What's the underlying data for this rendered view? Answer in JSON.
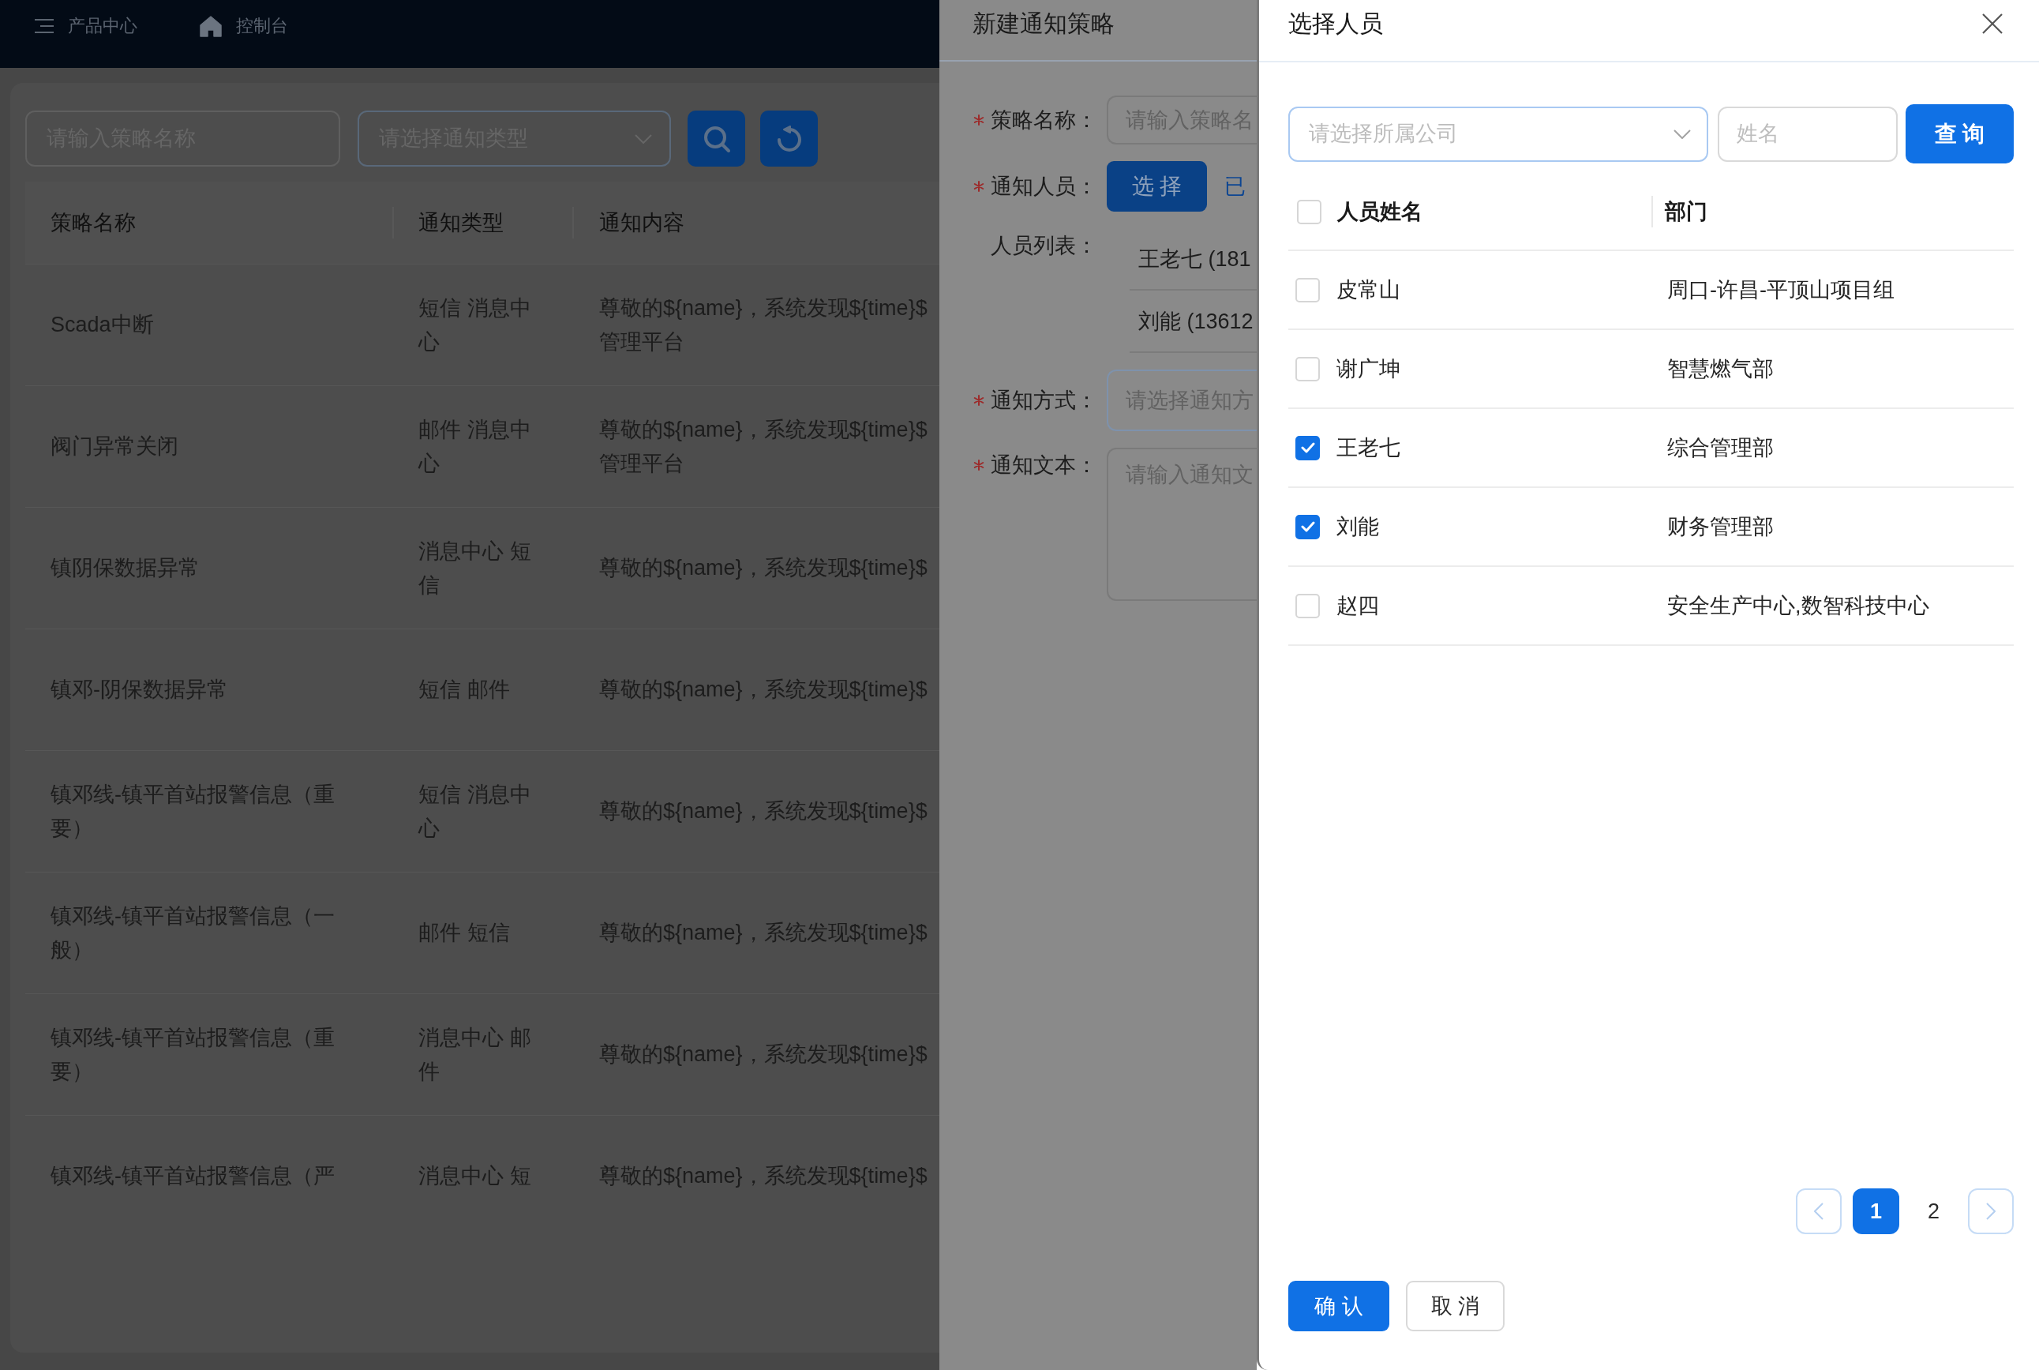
{
  "header": {
    "menu_label": "产品中心",
    "home_label": "控制台"
  },
  "filters": {
    "name_placeholder": "请输入策略名称",
    "type_placeholder": "请选择通知类型"
  },
  "table": {
    "columns": [
      "策略名称",
      "通知类型",
      "通知内容"
    ],
    "rows": [
      {
        "name": "Scada中断",
        "type": "短信 消息中心",
        "content_lines": [
          "尊敬的${name}，系统发现${time}$",
          "管理平台"
        ]
      },
      {
        "name": "阀门异常关闭",
        "type": "邮件 消息中心",
        "content_lines": [
          "尊敬的${name}，系统发现${time}$",
          "管理平台"
        ]
      },
      {
        "name": "镇阴保数据异常",
        "type": "消息中心 短信",
        "content_lines": [
          "尊敬的${name}，系统发现${time}$"
        ]
      },
      {
        "name": "镇邓-阴保数据异常",
        "type": "短信 邮件",
        "content_lines": [
          "尊敬的${name}，系统发现${time}$"
        ]
      },
      {
        "name": "镇邓线-镇平首站报警信息（重要）",
        "type": "短信 消息中心",
        "content_lines": [
          "尊敬的${name}，系统发现${time}$"
        ]
      },
      {
        "name": "镇邓线-镇平首站报警信息（一般）",
        "type": "邮件 短信",
        "content_lines": [
          "尊敬的${name}，系统发现${time}$"
        ]
      },
      {
        "name": "镇邓线-镇平首站报警信息（重要）",
        "type": "消息中心 邮件",
        "content_lines": [
          "尊敬的${name}，系统发现${time}$"
        ]
      },
      {
        "name": "镇邓线-镇平首站报警信息（严",
        "type": "消息中心 短",
        "content_lines": [
          "尊敬的${name}，系统发现${time}$"
        ]
      }
    ]
  },
  "policy_form": {
    "title": "新建通知策略",
    "fields": [
      {
        "kind": "input",
        "label": "策略名称：",
        "required": true,
        "placeholder": "请输入策略名"
      },
      {
        "kind": "picker",
        "label": "通知人员：",
        "required": true,
        "button": "选 择",
        "link": "已"
      },
      {
        "kind": "list",
        "label": "人员列表：",
        "required": false,
        "items": [
          "王老七 (181",
          "刘能 (13612"
        ]
      },
      {
        "kind": "select",
        "label": "通知方式：",
        "required": true,
        "placeholder": "请选择通知方"
      },
      {
        "kind": "textarea",
        "label": "通知文本：",
        "required": true,
        "placeholder": "请输入通知文"
      }
    ]
  },
  "person_picker": {
    "title": "选择人员",
    "company_placeholder": "请选择所属公司",
    "name_placeholder": "姓名",
    "search_button": "查 询",
    "columns": [
      "人员姓名",
      "部门"
    ],
    "all_checked": false,
    "rows": [
      {
        "name": "皮常山",
        "department": "周口-许昌-平顶山项目组",
        "checked": false
      },
      {
        "name": "谢广坤",
        "department": "智慧燃气部",
        "checked": false
      },
      {
        "name": "王老七",
        "department": "综合管理部",
        "checked": true
      },
      {
        "name": "刘能",
        "department": "财务管理部",
        "checked": true
      },
      {
        "name": "赵四",
        "department": "安全生产中心,数智科技中心",
        "checked": false
      }
    ],
    "pages": [
      {
        "label": "1",
        "selected": true
      },
      {
        "label": "2",
        "selected": false
      }
    ],
    "actions": [
      {
        "kind": "primary",
        "label": "确 认"
      },
      {
        "kind": "default",
        "label": "取 消"
      }
    ]
  }
}
